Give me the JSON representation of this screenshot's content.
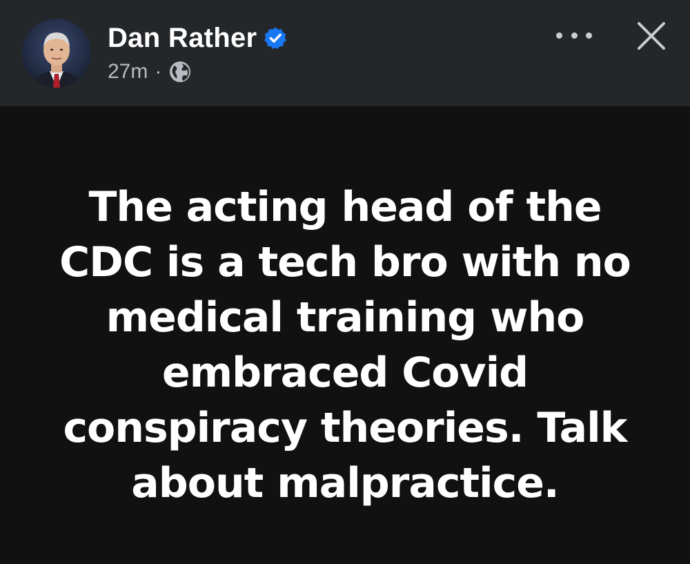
{
  "author": {
    "name": "Dan Rather",
    "verified": true,
    "avatar": "profile-photo"
  },
  "post_meta": {
    "time_ago": "27m",
    "separator": "·",
    "audience_icon": "globe-icon"
  },
  "actions": {
    "more_icon": "more-options-icon",
    "close_icon": "close-icon"
  },
  "post": {
    "lines": [
      "The acting head of the",
      "CDC is a tech bro with no",
      "medical training who",
      "embraced Covid",
      "conspiracy theories. Talk",
      "about malpractice."
    ]
  },
  "colors": {
    "header_bg": "#24272a",
    "post_bg": "#111111",
    "text": "#ffffff",
    "meta_text": "#b8bcc1",
    "verified_badge": "#1877f2"
  }
}
